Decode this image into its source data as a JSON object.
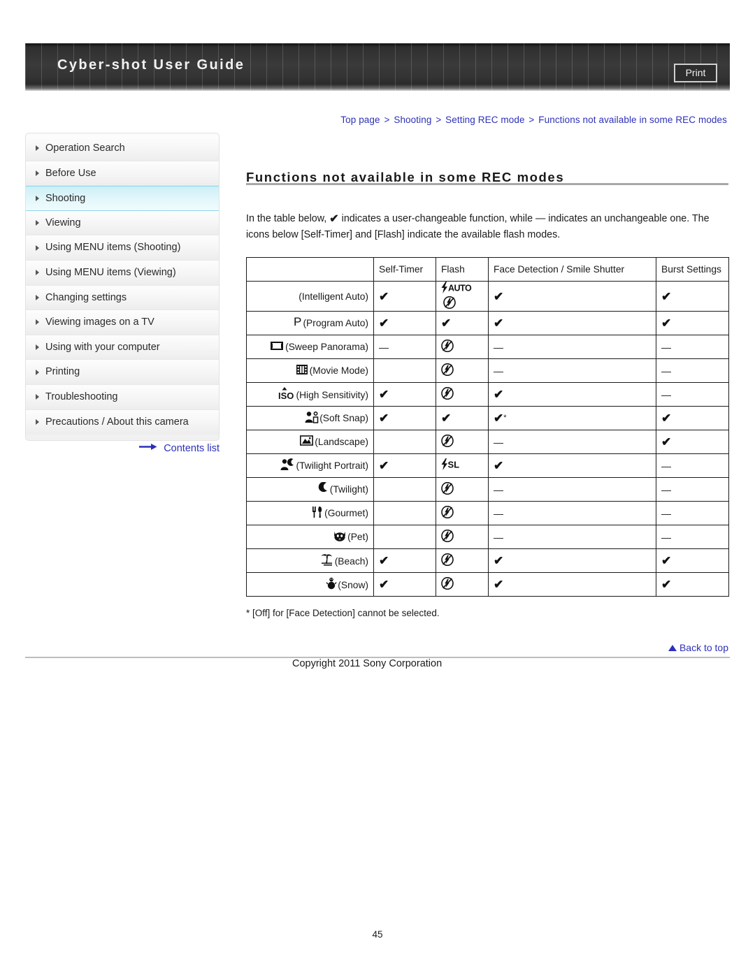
{
  "header": {
    "title": "Cyber-shot User Guide",
    "print_label": "Print"
  },
  "breadcrumb": {
    "items": [
      "Top page",
      "Shooting",
      "Setting REC mode",
      "Functions not available in some REC modes"
    ],
    "separator": ">",
    "color": "#2d30b8"
  },
  "sidebar": {
    "items": [
      {
        "label": "Operation Search",
        "active": false
      },
      {
        "label": "Before Use",
        "active": false
      },
      {
        "label": "Shooting",
        "active": true
      },
      {
        "label": "Viewing",
        "active": false
      },
      {
        "label": "Using MENU items (Shooting)",
        "active": false
      },
      {
        "label": "Using MENU items (Viewing)",
        "active": false
      },
      {
        "label": "Changing settings",
        "active": false
      },
      {
        "label": "Viewing images on a TV",
        "active": false
      },
      {
        "label": "Using with your computer",
        "active": false
      },
      {
        "label": "Printing",
        "active": false
      },
      {
        "label": "Troubleshooting",
        "active": false
      },
      {
        "label": "Precautions / About this camera",
        "active": false
      }
    ],
    "contents_link": "Contents list",
    "active_bg": "#d8f4fa",
    "active_border": "#8ed5e6"
  },
  "main": {
    "title": "Functions not available in some REC modes",
    "intro_part1": "In the table below,",
    "intro_check": "✔",
    "intro_part2": "indicates a user-changeable function, while — indicates an unchangeable one. The icons below [Self-Timer] and [Flash] indicate the available flash modes.",
    "footnote": "* [Off] for [Face Detection] cannot be selected."
  },
  "table": {
    "headers": [
      "",
      "Self-Timer",
      "Flash",
      "Face Detection / Smile Shutter",
      "Burst Settings"
    ],
    "rows": [
      {
        "icon": "none",
        "label": "(Intelligent Auto)",
        "self_timer": "check",
        "flash": "flash-auto-off",
        "face": "check",
        "burst": "check"
      },
      {
        "icon": "program-auto",
        "label": "(Program Auto)",
        "self_timer": "check",
        "flash": "check",
        "face": "check",
        "burst": "check"
      },
      {
        "icon": "sweep-panorama",
        "label": "(Sweep Panorama)",
        "self_timer": "dash",
        "flash": "flash-off",
        "face": "dash",
        "burst": "dash"
      },
      {
        "icon": "movie-mode",
        "label": "(Movie Mode)",
        "self_timer": "blank",
        "flash": "flash-off",
        "face": "dash",
        "burst": "dash"
      },
      {
        "icon": "high-sensitivity",
        "label": "(High Sensitivity)",
        "self_timer": "check",
        "flash": "flash-off",
        "face": "check",
        "burst": "dash"
      },
      {
        "icon": "soft-snap",
        "label": "(Soft Snap)",
        "self_timer": "check",
        "flash": "check",
        "face": "check-star",
        "burst": "check"
      },
      {
        "icon": "landscape",
        "label": "(Landscape)",
        "self_timer": "blank",
        "flash": "flash-off",
        "face": "dash",
        "burst": "check"
      },
      {
        "icon": "twilight-portrait",
        "label": "(Twilight Portrait)",
        "self_timer": "check",
        "flash": "flash-slow-sync",
        "face": "check",
        "burst": "dash"
      },
      {
        "icon": "twilight",
        "label": "(Twilight)",
        "self_timer": "blank",
        "flash": "flash-off",
        "face": "dash",
        "burst": "dash"
      },
      {
        "icon": "gourmet",
        "label": "(Gourmet)",
        "self_timer": "blank",
        "flash": "flash-off",
        "face": "dash",
        "burst": "dash"
      },
      {
        "icon": "pet",
        "label": "(Pet)",
        "self_timer": "blank",
        "flash": "flash-off",
        "face": "dash",
        "burst": "dash"
      },
      {
        "icon": "beach",
        "label": "(Beach)",
        "self_timer": "check",
        "flash": "flash-off",
        "face": "check",
        "burst": "check"
      },
      {
        "icon": "snow",
        "label": "(Snow)",
        "self_timer": "check",
        "flash": "flash-off",
        "face": "check",
        "burst": "check"
      }
    ]
  },
  "footer": {
    "back_to_top": "Back to top",
    "copyright": "Copyright 2011 Sony Corporation",
    "page_number": "45"
  }
}
